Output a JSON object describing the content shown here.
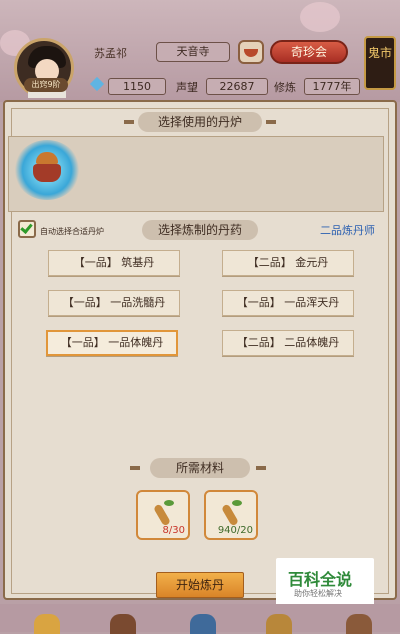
{
  "header": {
    "player_name": "苏孟祁",
    "avatar_tag": "出窍9阶",
    "location": "天音寺",
    "treasure_button": "奇珍会",
    "gm_icon_label": "鬼市",
    "gems": "1150",
    "fame_label": "声望",
    "fame": "22687",
    "cultivation_label": "修炼",
    "cultivation": "1777年"
  },
  "furnace_section": {
    "title": "选择使用的丹炉"
  },
  "recipe_section": {
    "title": "选择炼制的丹药",
    "auto_select_label": "自动选择合适丹炉",
    "auto_select_checked": true,
    "alchemist_rank": "二品炼丹师",
    "recipes": [
      {
        "label": "【一品】 筑基丹"
      },
      {
        "label": "【二品】 金元丹"
      },
      {
        "label": "【一品】 一品洗髓丹"
      },
      {
        "label": "【一品】 一品浑天丹"
      },
      {
        "label": "【一品】 一品体魄丹",
        "selected": true
      },
      {
        "label": "【二品】 二品体魄丹"
      }
    ]
  },
  "materials_section": {
    "title": "所需材料",
    "items": [
      {
        "icon": "ginseng-icon",
        "quantity": "8/30",
        "status": "insufficient"
      },
      {
        "icon": "ginseng-icon",
        "quantity": "940/20",
        "status": "sufficient"
      }
    ]
  },
  "start_button": "开始炼丹",
  "watermark": {
    "title": "百科全说",
    "subtitle": "助你轻松解决"
  }
}
